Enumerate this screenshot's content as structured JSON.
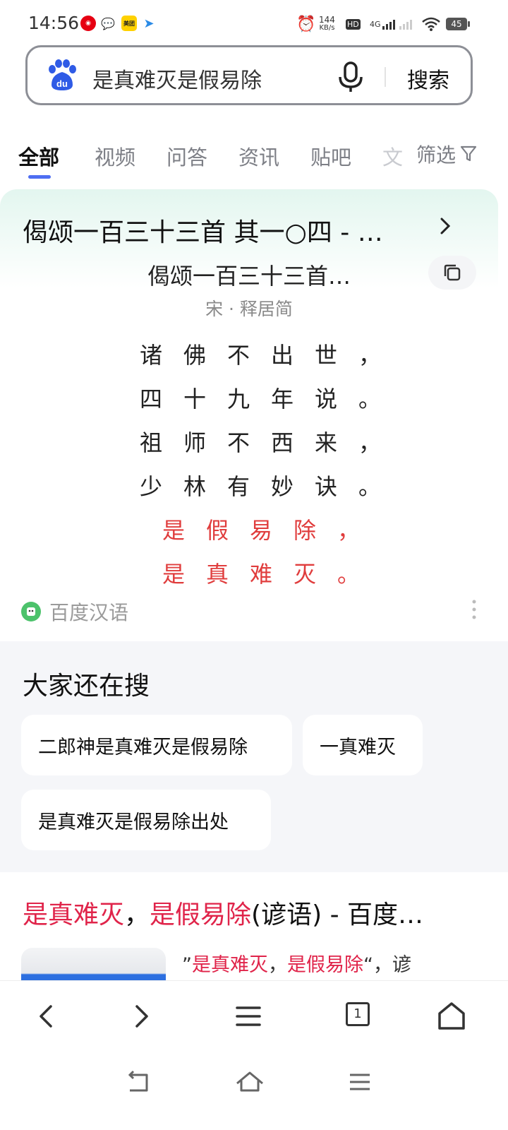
{
  "status_bar": {
    "time": "14:56",
    "net_speed_value": "144",
    "net_speed_unit": "KB/s",
    "hd_label": "HD",
    "network_label": "4G",
    "battery": "45",
    "app_meituan": "美团"
  },
  "search": {
    "query": "是真难灭是假易除",
    "button_label": "搜索",
    "logo_text": "du"
  },
  "tabs": [
    {
      "label": "全部"
    },
    {
      "label": "视频"
    },
    {
      "label": "问答"
    },
    {
      "label": "资讯"
    },
    {
      "label": "贴吧"
    },
    {
      "label": "文"
    }
  ],
  "filter_label": "筛选",
  "poem_card": {
    "header": "偈颂一百三十三首 其一○四 - …",
    "title": "偈颂一百三十三首…",
    "author": "宋 · 释居简",
    "lines": [
      "诸佛不出世，",
      "四十九年说。",
      "祖师不西来，",
      "少林有妙诀。"
    ],
    "highlight_lines": [
      "是假易除，",
      "是真难灭。"
    ],
    "source": "百度汉语"
  },
  "related": {
    "title": "大家还在搜",
    "chips": [
      "二郎神是真难灭是假易除",
      "一真难灭",
      "是真难灭是假易除出处"
    ]
  },
  "result": {
    "title_hl1": "是真难灭",
    "title_sep": "，",
    "title_hl2": "是假易除",
    "title_rest": "(谚语) - 百度…",
    "snippet_open": "”",
    "snippet_hl1": "是真难灭",
    "snippet_sep": "，",
    "snippet_hl2": "是假易除",
    "snippet_rest": "“，谚"
  },
  "toolbar": {
    "tab_count": "1"
  }
}
